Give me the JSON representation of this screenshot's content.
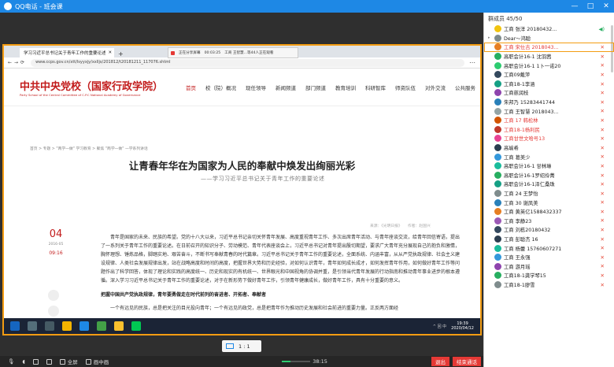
{
  "window": {
    "title": "QQ电话 - 班会课",
    "controls": [
      "—",
      "□",
      "✕"
    ]
  },
  "share_banner": {
    "status": "正在分享屏幕",
    "timer": "00:03:25",
    "info": "工商 王智慧...等44人正在观看"
  },
  "browser": {
    "tab_title": "学习习近平总书记关于青年工作的重要论述",
    "url": "www.ccps.gov.cn/xtt/lsyyxjy/xxlljs/201812/t20181211_117076.shtml"
  },
  "site": {
    "logo_cn": "中共中央党校（国家行政学院）",
    "logo_en": "Party School of the Central Committee of C.P.C   National Academy of Governance",
    "nav": [
      "首页",
      "校（院）概况",
      "现任领导",
      "新闻频道",
      "部门频道",
      "教育培训",
      "科研智库",
      "师资队伍",
      "对外交流",
      "公共服务"
    ],
    "breadcrumb": "首页 > 专题 > \"两学一做\" 学习教育 > 聚焦 \"两学一做\" 一学系列讲话"
  },
  "article": {
    "title": "让青春年华在为国家为人民的奉献中焕发出绚丽光彩",
    "subtitle": "——学习习近平总书记关于青年工作的重要论述",
    "day": "04",
    "year_month": "2016-05",
    "time": "09:16",
    "meta": "来源：《光明日报》　　作者：赵国兴",
    "paragraphs": [
      "青年是国家的未来、民族的希望。党的十八大以来，习近平总书记亲切关怀青年发展、高度重视青年工作、多次出席青年活动、与青年座谈交流，给青年回信寄语，提出了一系列关于青年工作的重要论述。在日前召开的知识分子、劳动模范、青年代表座谈会上，习近平总书记对青年提出殷切期望，要求广大青年充分展现自己的抱负和激情，胸怀理想、锤炼品格，脚踏实地、艰苦奋斗，不断书写奉献青春的时代篇章。习近平总书记关于青年工作的重要论述，全面系统、内涵丰富，从从严党执政规律、社会主义建设规律、人类社会发展规律出发，站在战略高度和时间的高度，把握世界大势和历史经验，对如何认识青年，青年如何成长成才，如何发挥青年作用，如何做好青年工作等问题作出了科学回答，体现了理论和实践的高度统一、历史和现实的有机统一、世界眼光和中国视角的协调并重，是引领当代青年发展的行动指南和推动青年事业进步的根本遵循。深入学习习近平总书记关于青年工作的重要论述，对于在新形势下做好青年工作，引领青年健康成长，做好青年工作，具有十分重要的意义。"
    ],
    "heading": "把握中国共产党执政规律，青年要勇做走在时代前列的奋进者、开拓者、奉献者",
    "cut_line": "一个有远见的民族，总是把关注的目光投向青年；一个有远见的政党，总是把青年作为推动历史发展和社会前进的重要力量。正反两方面经"
  },
  "taskbar": {
    "clock_time": "19:39",
    "clock_date": "2020/04/12",
    "tray": "^ 回 中"
  },
  "ratio": "1 : 1",
  "bottom": {
    "fullscreen": "全屏",
    "pip": "画中画",
    "timer": "38:15",
    "exit": "退出",
    "end_call": "结束通话"
  },
  "members": {
    "header": "群成员 45/50",
    "list": [
      {
        "name": "工商  张洋  20180432...",
        "color": "#f1c40f",
        "caret": "",
        "mic": "on",
        "red": false,
        "sel": false
      },
      {
        "name": "Dear～鸿聪",
        "color": "#7f8c8d",
        "caret": "▸",
        "mic": "",
        "red": false,
        "sel": false
      },
      {
        "name": "工商  宋仕吉  2018043...",
        "color": "#e67e22",
        "caret": "",
        "mic": "off",
        "red": true,
        "sel": true
      },
      {
        "name": "高职会计16-1  沈羽茜",
        "color": "#27ae60",
        "caret": "",
        "mic": "off",
        "red": false,
        "sel": false
      },
      {
        "name": "高职会计16-1  1卜一诺20",
        "color": "#2ecc71",
        "caret": "",
        "mic": "off",
        "red": false,
        "sel": false
      },
      {
        "name": "工商09戴萍",
        "color": "#34495e",
        "caret": "",
        "mic": "off",
        "red": false,
        "sel": false
      },
      {
        "name": "工商18-1李涵",
        "color": "#16a085",
        "caret": "",
        "mic": "off",
        "red": false,
        "sel": false
      },
      {
        "name": "工商慈润枝",
        "color": "#8e44ad",
        "caret": "",
        "mic": "off",
        "red": false,
        "sel": false
      },
      {
        "name": "朱邦乃  15283441744",
        "color": "#2980b9",
        "caret": "",
        "mic": "off",
        "red": false,
        "sel": false
      },
      {
        "name": "工商  王智慧  2018043...",
        "color": "#95a5a6",
        "caret": "",
        "mic": "off",
        "red": false,
        "sel": false
      },
      {
        "name": "工商  17  韩松林",
        "color": "#d35400",
        "caret": "",
        "mic": "off",
        "red": true,
        "sel": false
      },
      {
        "name": "工商18-1杨利民",
        "color": "#c0392b",
        "caret": "",
        "mic": "off",
        "red": true,
        "sel": false
      },
      {
        "name": "工商甘世文哈号13",
        "color": "#e84393",
        "caret": "",
        "mic": "off",
        "red": true,
        "sel": false
      },
      {
        "name": "高瑜希",
        "color": "#2c3e50",
        "caret": "",
        "mic": "off",
        "red": false,
        "sel": false
      },
      {
        "name": "工商  葛美少",
        "color": "#3498db",
        "caret": "",
        "mic": "off",
        "red": false,
        "sel": false
      },
      {
        "name": "高职会计16-1  甘林琳",
        "color": "#1abc9c",
        "caret": "",
        "mic": "off",
        "red": false,
        "sel": false
      },
      {
        "name": "高职会计16-1罗绍伶菁",
        "color": "#27ae60",
        "caret": "",
        "mic": "off",
        "red": false,
        "sel": false
      },
      {
        "name": "高职会计16-1泽仁桑珠",
        "color": "#16a085",
        "caret": "",
        "mic": "off",
        "red": false,
        "sel": false
      },
      {
        "name": "工商  24  王梦怡",
        "color": "#7f8c8d",
        "caret": "",
        "mic": "off",
        "red": false,
        "sel": false
      },
      {
        "name": "工商  30  谢凤美",
        "color": "#2980b9",
        "caret": "",
        "mic": "off",
        "red": false,
        "sel": false
      },
      {
        "name": "工商  黄英亿1588432337",
        "color": "#e67e22",
        "caret": "",
        "mic": "off",
        "red": false,
        "sel": false
      },
      {
        "name": "工商  李静23",
        "color": "#9b59b6",
        "caret": "",
        "mic": "off",
        "red": false,
        "sel": false
      },
      {
        "name": "工商  刘栋20180432",
        "color": "#34495e",
        "caret": "",
        "mic": "off",
        "red": false,
        "sel": false
      },
      {
        "name": "工商  彭聪杰  16",
        "color": "#2c3e50",
        "caret": "",
        "mic": "off",
        "red": false,
        "sel": false
      },
      {
        "name": "工商  杨蕾  15760607271",
        "color": "#1abc9c",
        "caret": "",
        "mic": "off",
        "red": false,
        "sel": false
      },
      {
        "name": "工商  王永强",
        "color": "#3498db",
        "caret": "",
        "mic": "off",
        "red": false,
        "sel": false
      },
      {
        "name": "工商  游月瑶",
        "color": "#8e44ad",
        "caret": "",
        "mic": "off",
        "red": false,
        "sel": false
      },
      {
        "name": "工商18-1龚学琴15",
        "color": "#27ae60",
        "caret": "",
        "mic": "off",
        "red": false,
        "sel": false
      },
      {
        "name": "工商18-1廖雪",
        "color": "#7f8c8d",
        "caret": "",
        "mic": "off",
        "red": false,
        "sel": false
      }
    ]
  }
}
